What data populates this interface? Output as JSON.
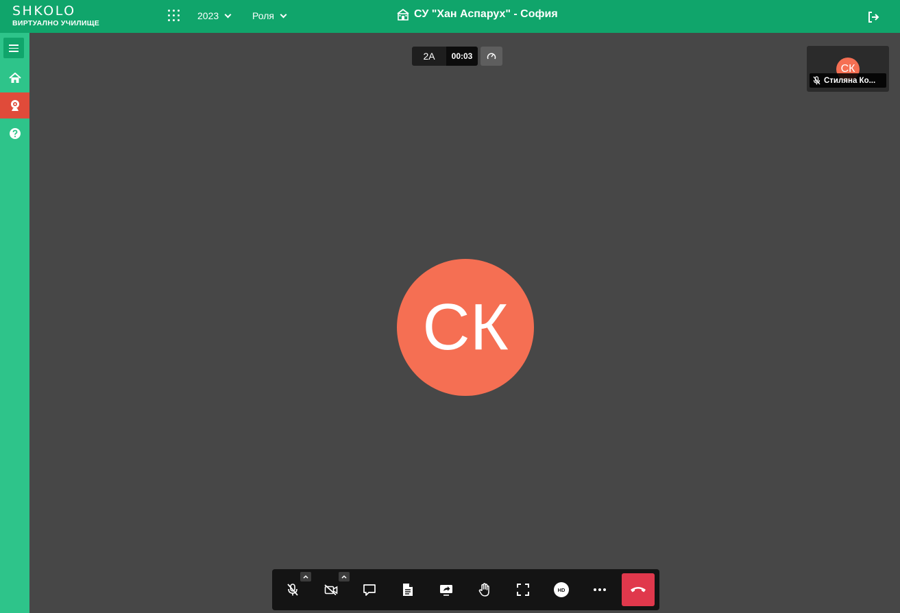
{
  "header": {
    "logo_text": "SHKOLO",
    "logo_sub": "ВИРТУАЛНО УЧИЛИЩЕ",
    "year": "2023",
    "role": "Роля",
    "school": "СУ \"Хан Аспарух\" - София",
    "icons": [
      "apps-grid-icon",
      "school-building-icon",
      "logout-icon"
    ]
  },
  "sidebar": {
    "items": [
      {
        "name": "menu",
        "icon": "hamburger-icon"
      },
      {
        "name": "home",
        "icon": "home-icon"
      },
      {
        "name": "webcam",
        "icon": "webcam-icon",
        "active": true
      },
      {
        "name": "help",
        "icon": "help-icon"
      }
    ]
  },
  "conference": {
    "room": "2А",
    "timer": "00:03",
    "speaker_initials": "СК",
    "thumbnail": {
      "initials": "СК",
      "name": "Стиляна Ко..."
    }
  },
  "toolbar": {
    "buttons": [
      "mic-muted-icon",
      "camera-off-icon",
      "chat-icon",
      "document-icon",
      "screen-share-icon",
      "raise-hand-icon",
      "fullscreen-icon",
      "hd-quality-icon",
      "more-options-icon",
      "hang-up-icon"
    ],
    "hd_label": "HD"
  },
  "colors": {
    "header_green": "#10a56b",
    "sidebar_green": "#2ec48a",
    "active_red": "#e04b3a",
    "avatar_coral": "#f56f53",
    "stage_gray": "#474747",
    "hangup_red": "#e0384c"
  }
}
